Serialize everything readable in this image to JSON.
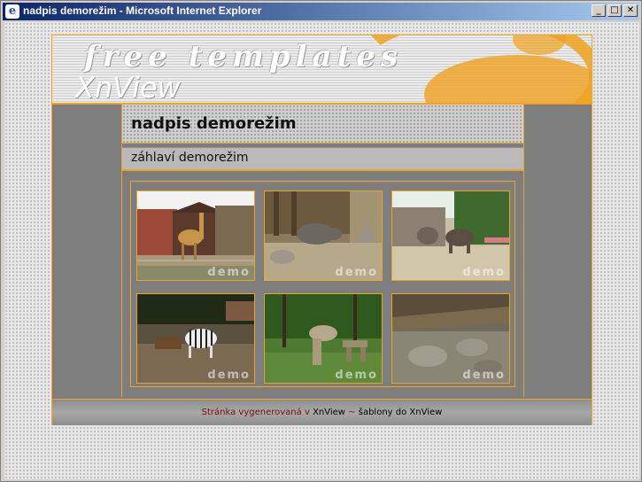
{
  "window": {
    "title": "nadpis demorežim - Microsoft Internet Explorer",
    "controls": {
      "minimize": "_",
      "maximize": "□",
      "close": "✕"
    }
  },
  "banner": {
    "line1": "free templates",
    "line2": "XnView"
  },
  "heading": "nadpis demorežim",
  "subheading": "záhlaví demorežim",
  "gallery": {
    "watermark": "demo",
    "thumbnails": [
      {
        "subject": "giraffe"
      },
      {
        "subject": "rhinoceros"
      },
      {
        "subject": "elephants"
      },
      {
        "subject": "zebra"
      },
      {
        "subject": "rock sculpture"
      },
      {
        "subject": "enclosure"
      }
    ]
  },
  "footer": {
    "generated_by": "Stránka vygenerovaná v",
    "app_link": "XnView",
    "separator": "~",
    "templates_link": "šablony do XnView"
  },
  "colors": {
    "accent": "#f0a31e",
    "page_bg": "#7d7d7d",
    "footer_red": "#7a0d0d"
  }
}
